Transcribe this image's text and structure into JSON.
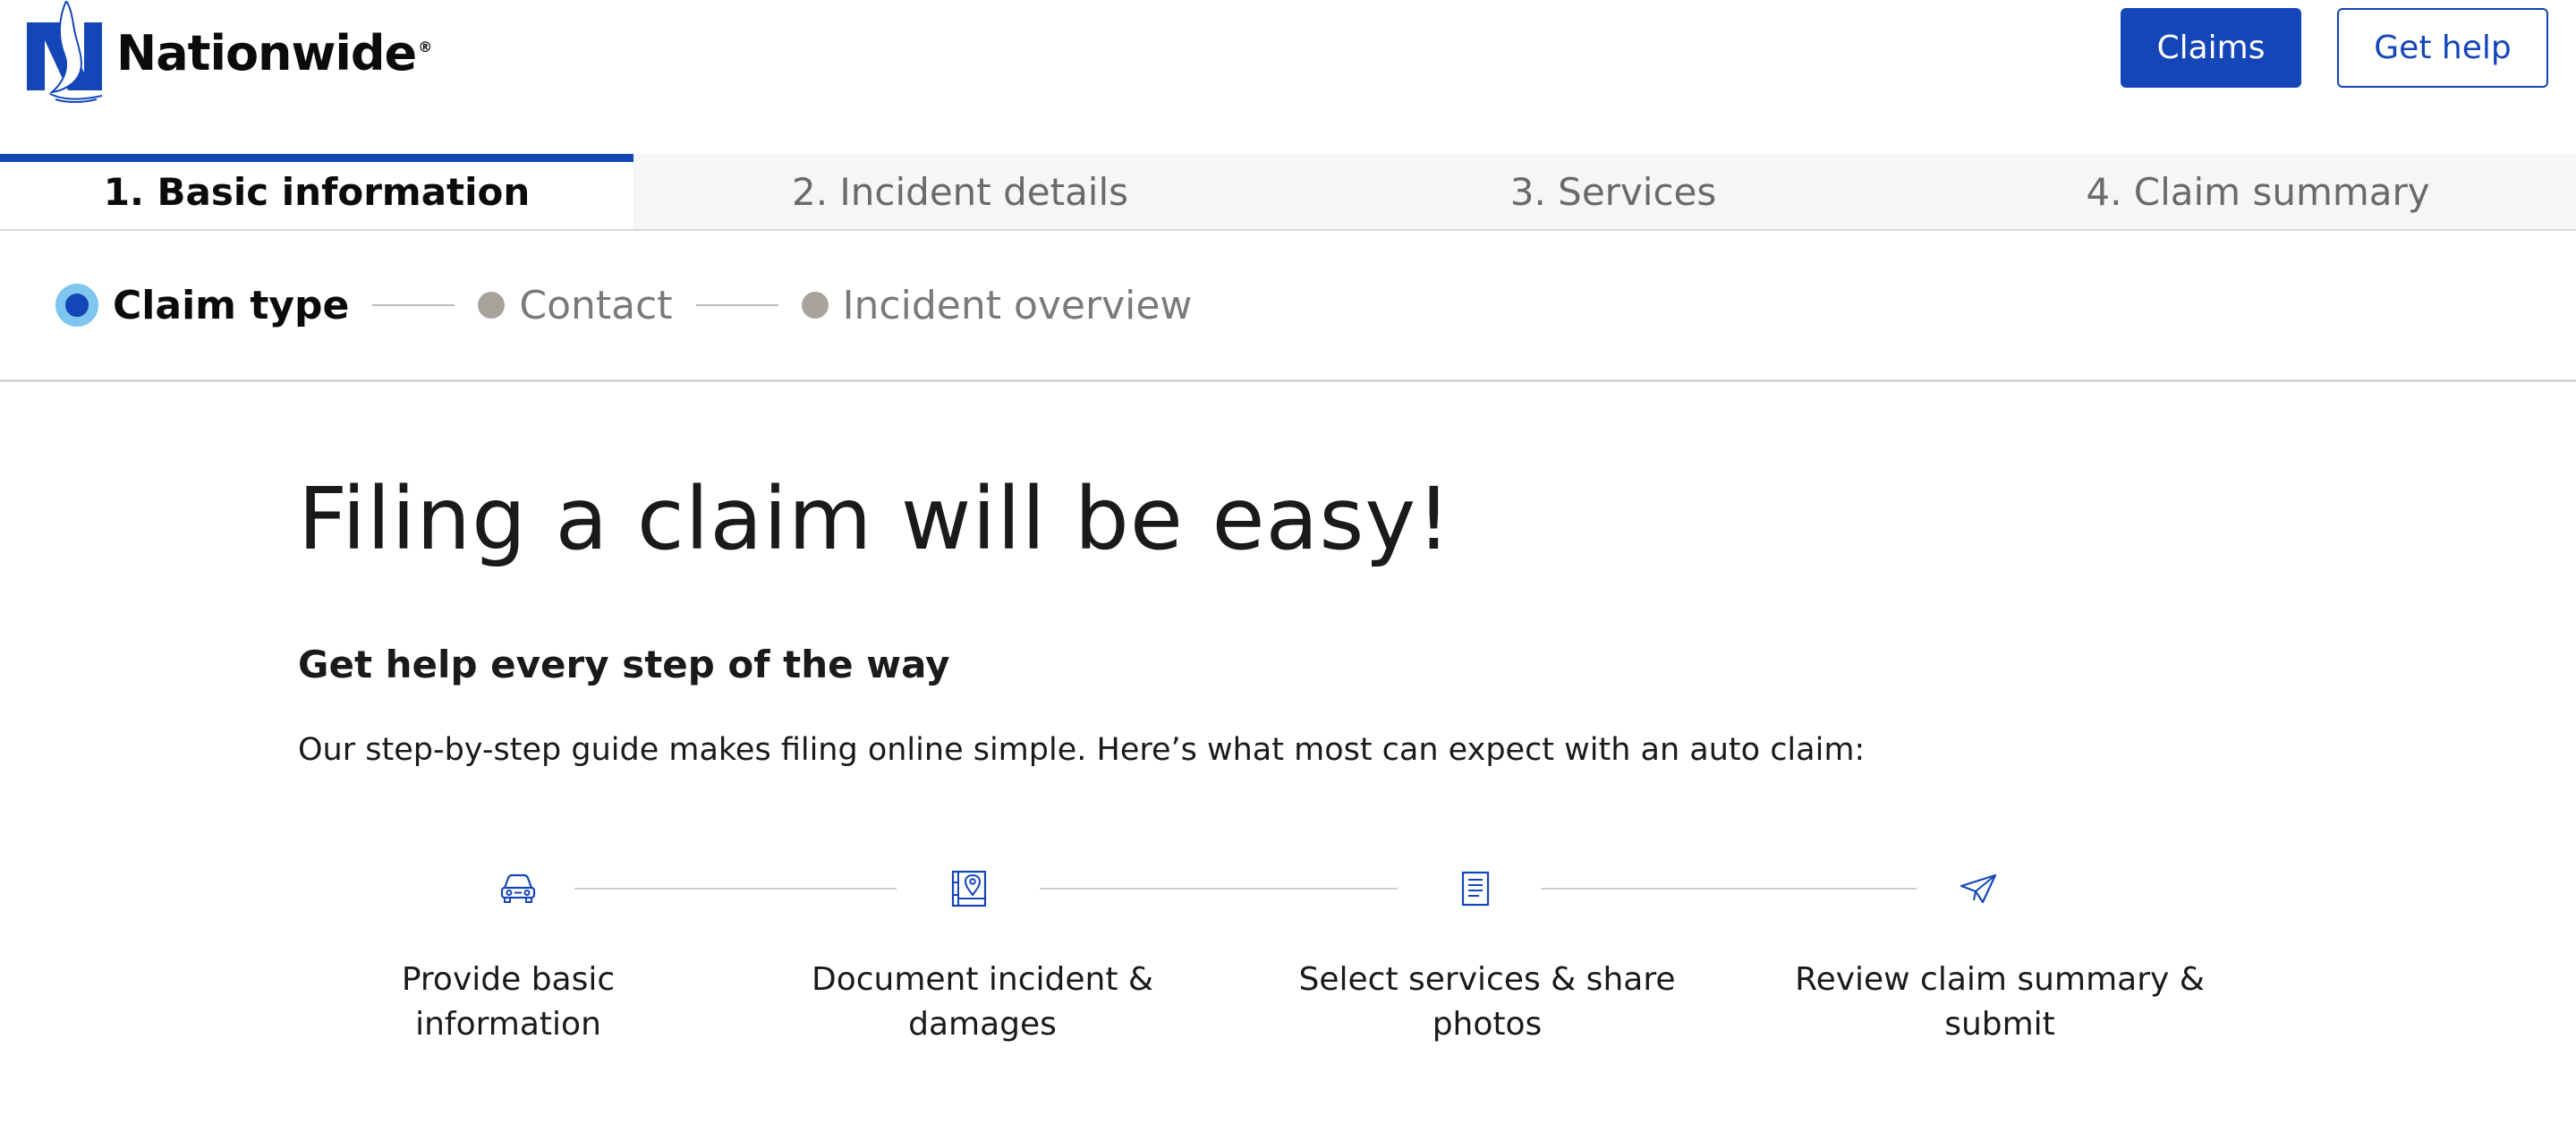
{
  "header": {
    "brand": "Nationwide",
    "brand_mark": "®",
    "claims_button": "Claims",
    "help_button": "Get help"
  },
  "tabs": [
    {
      "label": "1. Basic information",
      "active": true
    },
    {
      "label": "2. Incident details",
      "active": false
    },
    {
      "label": "3. Services",
      "active": false
    },
    {
      "label": "4. Claim summary",
      "active": false
    }
  ],
  "substeps": [
    {
      "label": "Claim type",
      "active": true
    },
    {
      "label": "Contact",
      "active": false
    },
    {
      "label": "Incident overview",
      "active": false
    }
  ],
  "content": {
    "title": "Filing a claim will be easy!",
    "subtitle": "Get help every step of the way",
    "intro": "Our step-by-step guide makes filing online simple. Here’s what most can expect with an auto claim:"
  },
  "flow": [
    {
      "icon": "car-icon",
      "line1": "Provide basic",
      "line2": "information"
    },
    {
      "icon": "map-pin-icon",
      "line1": "Document incident &",
      "line2": "damages"
    },
    {
      "icon": "document-icon",
      "line1": "Select services & share",
      "line2": "photos"
    },
    {
      "icon": "paper-plane-icon",
      "line1": "Review claim summary &",
      "line2": "submit"
    }
  ],
  "colors": {
    "brand_blue": "#1446b8",
    "active_ring": "#7ec6ee",
    "inactive_dot": "#a8a49c"
  }
}
